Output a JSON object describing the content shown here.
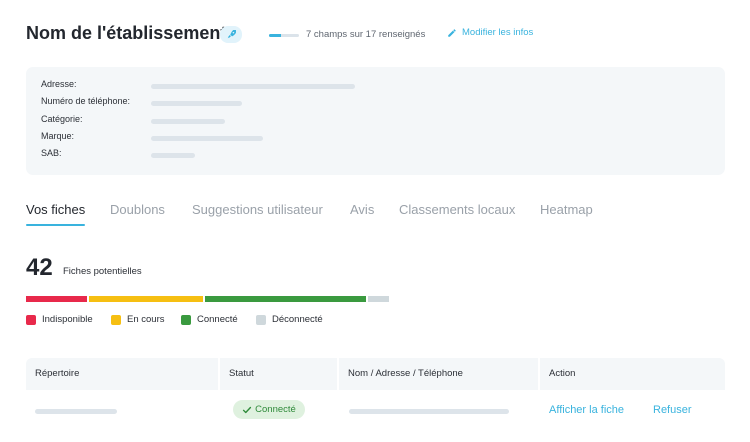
{
  "header": {
    "title": "Nom de l'établissement",
    "rocket_icon": "rocket-icon",
    "completion_text": "7 champs sur 17 renseignés",
    "completion": {
      "filled": 7,
      "total": 17
    },
    "edit_label": "Modifier les infos",
    "edit_icon": "pencil-icon"
  },
  "info": {
    "fields": [
      {
        "label": "Adresse:"
      },
      {
        "label": "Numéro de téléphone:"
      },
      {
        "label": "Catégorie:"
      },
      {
        "label": "Marque:"
      },
      {
        "label": "SAB:"
      }
    ]
  },
  "tabs": [
    {
      "label": "Vos fiches",
      "active": true
    },
    {
      "label": "Doublons",
      "active": false
    },
    {
      "label": "Suggestions utilisateur",
      "active": false
    },
    {
      "label": "Avis",
      "active": false
    },
    {
      "label": "Classements locaux",
      "active": false
    },
    {
      "label": "Heatmap",
      "active": false
    }
  ],
  "summary": {
    "count": "42",
    "count_label": "Fiches potentielles"
  },
  "status_breakdown": [
    {
      "label": "Indisponible",
      "color": "#e8294b",
      "share": 0.17
    },
    {
      "label": "En cours",
      "color": "#f6bf12",
      "share": 0.32
    },
    {
      "label": "Connecté",
      "color": "#3a9a3f",
      "share": 0.45
    },
    {
      "label": "Déconnecté",
      "color": "#cfd8dc",
      "share": 0.06
    }
  ],
  "table": {
    "columns": [
      "Répertoire",
      "Statut",
      "Nom / Adresse / Téléphone",
      "Action"
    ],
    "row": {
      "status": "Connecté",
      "status_icon": "check-icon",
      "view_action": "Afficher la fiche",
      "reject_action": "Refuser"
    }
  },
  "colors": {
    "accent": "#39b3de",
    "connected_bg": "#dff1df",
    "connected_text": "#2f8a3a"
  }
}
